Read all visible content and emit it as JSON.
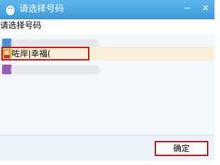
{
  "window": {
    "title": "请选择号码",
    "minimize_glyph": "−",
    "close_glyph": "✕"
  },
  "dialog": {
    "prompt": "请选择号码"
  },
  "accounts": [
    {
      "label": "",
      "avatar_color": "#4a90d9"
    },
    {
      "label": "咗岸|幸福(",
      "avatar_color": "#d9a34a",
      "selected": true
    },
    {
      "label": "",
      "avatar_color": "#9b59b6"
    }
  ],
  "footer": {
    "ok_label": "确定"
  },
  "colors": {
    "titlebar": "#4aa6e0",
    "selected_row": "#f7efd6",
    "highlight": "#d01010"
  },
  "icons": {
    "window_icon": "qq-penguin-icon"
  }
}
